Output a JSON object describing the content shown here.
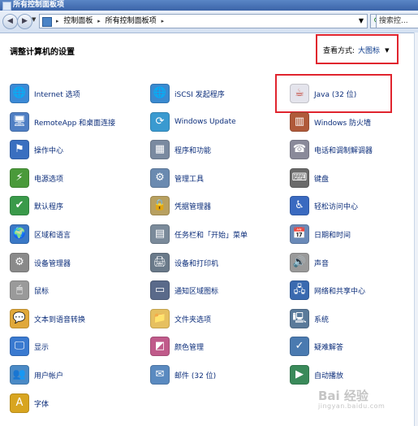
{
  "window": {
    "title": "所有控制面板项"
  },
  "address": {
    "crumbs": [
      "控制面板",
      "所有控制面板项"
    ],
    "search_placeholder": "搜索控..."
  },
  "heading": "调整计算机的设置",
  "view_by": {
    "label": "查看方式:",
    "value": "大图标"
  },
  "watermark": {
    "brand": "Bai 经验",
    "site": "jingyan.baidu.com"
  },
  "columns": [
    [
      {
        "label": "Internet 选项",
        "icon": "globe-checklist-icon",
        "color": "#3b8ad6",
        "glyph": "🌐"
      },
      {
        "label": "RemoteApp 和桌面连接",
        "icon": "remote-desktop-icon",
        "color": "#4f7fc4",
        "glyph": "🖥"
      },
      {
        "label": "操作中心",
        "icon": "flag-icon",
        "color": "#3a6fc0",
        "glyph": "⚑"
      },
      {
        "label": "电源选项",
        "icon": "power-plug-icon",
        "color": "#4a9a3a",
        "glyph": "⚡"
      },
      {
        "label": "默认程序",
        "icon": "default-programs-icon",
        "color": "#3a9a4a",
        "glyph": "✔"
      },
      {
        "label": "区域和语言",
        "icon": "globe-clock-icon",
        "color": "#3a78c6",
        "glyph": "🌍"
      },
      {
        "label": "设备管理器",
        "icon": "device-manager-icon",
        "color": "#8a8a8a",
        "glyph": "⚙"
      },
      {
        "label": "鼠标",
        "icon": "mouse-icon",
        "color": "#9a9a9a",
        "glyph": "🖱"
      },
      {
        "label": "文本到语音转换",
        "icon": "speech-bubble-icon",
        "color": "#e0a83a",
        "glyph": "💬"
      },
      {
        "label": "显示",
        "icon": "monitor-icon",
        "color": "#3a7ad0",
        "glyph": "🖵"
      },
      {
        "label": "用户帐户",
        "icon": "user-accounts-icon",
        "color": "#4a8ac6",
        "glyph": "👥"
      },
      {
        "label": "字体",
        "icon": "font-icon",
        "color": "#d8a520",
        "glyph": "A"
      }
    ],
    [
      {
        "label": "iSCSI 发起程序",
        "icon": "iscsi-globe-icon",
        "color": "#3a8ad0",
        "glyph": "🌐"
      },
      {
        "label": "Windows Update",
        "icon": "windows-update-icon",
        "color": "#3a9ad0",
        "glyph": "⟳"
      },
      {
        "label": "程序和功能",
        "icon": "programs-icon",
        "color": "#7a8aa0",
        "glyph": "▦"
      },
      {
        "label": "管理工具",
        "icon": "admin-tools-icon",
        "color": "#6a8ab0",
        "glyph": "⚙"
      },
      {
        "label": "凭据管理器",
        "icon": "credential-vault-icon",
        "color": "#b8a060",
        "glyph": "🔒"
      },
      {
        "label": "任务栏和「开始」菜单",
        "icon": "taskbar-icon",
        "color": "#7a8a9a",
        "glyph": "▤"
      },
      {
        "label": "设备和打印机",
        "icon": "printer-icon",
        "color": "#6a7a8a",
        "glyph": "🖨"
      },
      {
        "label": "通知区域图标",
        "icon": "notification-area-icon",
        "color": "#5a6a8a",
        "glyph": "▭"
      },
      {
        "label": "文件夹选项",
        "icon": "folder-options-icon",
        "color": "#e6c060",
        "glyph": "📁"
      },
      {
        "label": "颜色管理",
        "icon": "color-management-icon",
        "color": "#c05a8a",
        "glyph": "◩"
      },
      {
        "label": "邮件 (32 位)",
        "icon": "mail-icon",
        "color": "#5a8ac0",
        "glyph": "✉"
      }
    ],
    [
      {
        "label": "Java (32 位)",
        "icon": "java-cup-icon",
        "color": "#e4e4ec",
        "glyph": "☕"
      },
      {
        "label": "Windows 防火墙",
        "icon": "firewall-icon",
        "color": "#b05a3a",
        "glyph": "▥"
      },
      {
        "label": "电话和调制解调器",
        "icon": "phone-modem-icon",
        "color": "#8a8a9a",
        "glyph": "☎"
      },
      {
        "label": "键盘",
        "icon": "keyboard-icon",
        "color": "#6a6a6a",
        "glyph": "⌨"
      },
      {
        "label": "轻松访问中心",
        "icon": "ease-of-access-icon",
        "color": "#3a6ac0",
        "glyph": "♿"
      },
      {
        "label": "日期和时间",
        "icon": "calendar-clock-icon",
        "color": "#6a8ab8",
        "glyph": "📅"
      },
      {
        "label": "声音",
        "icon": "speaker-icon",
        "color": "#9a9a9a",
        "glyph": "🔊"
      },
      {
        "label": "网络和共享中心",
        "icon": "network-icon",
        "color": "#3a6ab0",
        "glyph": "🖧"
      },
      {
        "label": "系统",
        "icon": "system-icon",
        "color": "#5a7a9a",
        "glyph": "🖳"
      },
      {
        "label": "疑难解答",
        "icon": "troubleshooting-icon",
        "color": "#4a7ab0",
        "glyph": "✓"
      },
      {
        "label": "自动播放",
        "icon": "autoplay-icon",
        "color": "#3a8a5a",
        "glyph": "▶"
      }
    ]
  ]
}
